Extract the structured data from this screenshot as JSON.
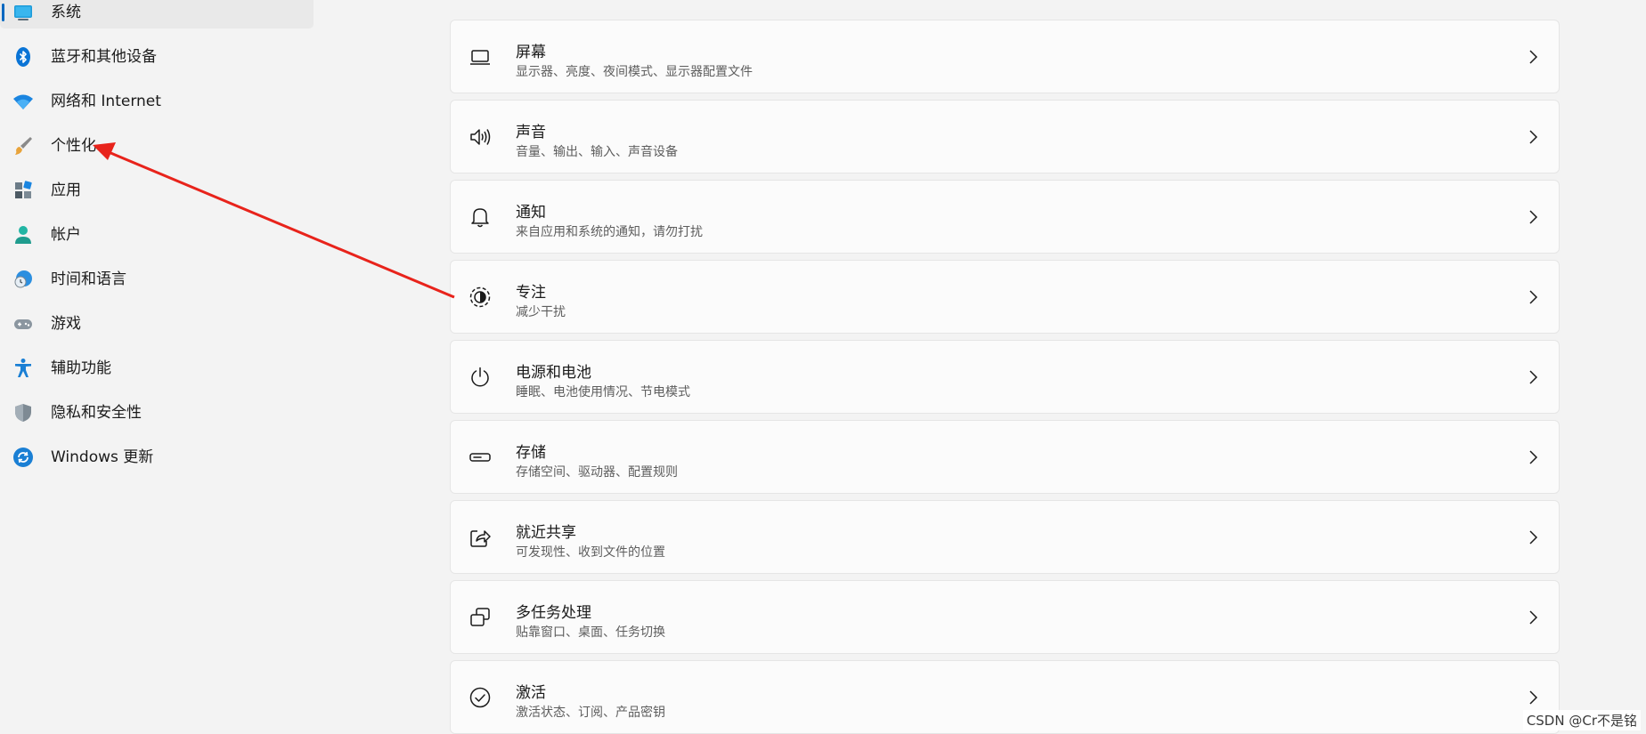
{
  "sidebar": {
    "items": [
      {
        "label": "系统",
        "icon": "system-display-icon",
        "selected": true
      },
      {
        "label": "蓝牙和其他设备",
        "icon": "bluetooth-icon"
      },
      {
        "label": "网络和 Internet",
        "icon": "wifi-icon"
      },
      {
        "label": "个性化",
        "icon": "paintbrush-icon"
      },
      {
        "label": "应用",
        "icon": "apps-icon"
      },
      {
        "label": "帐户",
        "icon": "account-icon"
      },
      {
        "label": "时间和语言",
        "icon": "time-language-icon"
      },
      {
        "label": "游戏",
        "icon": "gamepad-icon"
      },
      {
        "label": "辅助功能",
        "icon": "accessibility-icon"
      },
      {
        "label": "隐私和安全性",
        "icon": "shield-icon"
      },
      {
        "label": "Windows 更新",
        "icon": "windows-update-icon"
      }
    ]
  },
  "settings": [
    {
      "title": "屏幕",
      "subtitle": "显示器、亮度、夜间模式、显示器配置文件",
      "icon": "laptop-display-icon"
    },
    {
      "title": "声音",
      "subtitle": "音量、输出、输入、声音设备",
      "icon": "speaker-icon"
    },
    {
      "title": "通知",
      "subtitle": "来自应用和系统的通知，请勿打扰",
      "icon": "bell-icon"
    },
    {
      "title": "专注",
      "subtitle": "减少干扰",
      "icon": "focus-icon"
    },
    {
      "title": "电源和电池",
      "subtitle": "睡眠、电池使用情况、节电模式",
      "icon": "power-icon"
    },
    {
      "title": "存储",
      "subtitle": "存储空间、驱动器、配置规则",
      "icon": "storage-drive-icon"
    },
    {
      "title": "就近共享",
      "subtitle": "可发现性、收到文件的位置",
      "icon": "share-icon"
    },
    {
      "title": "多任务处理",
      "subtitle": "贴靠窗口、桌面、任务切换",
      "icon": "multitasking-icon"
    },
    {
      "title": "激活",
      "subtitle": "激活状态、订阅、产品密钥",
      "icon": "activation-check-icon"
    }
  ],
  "colors": {
    "accent": "#0067c0",
    "background": "#f3f3f3",
    "card": "#fbfbfb",
    "annotation_arrow": "#e8231b"
  },
  "watermark": "CSDN @Cr不是铭"
}
